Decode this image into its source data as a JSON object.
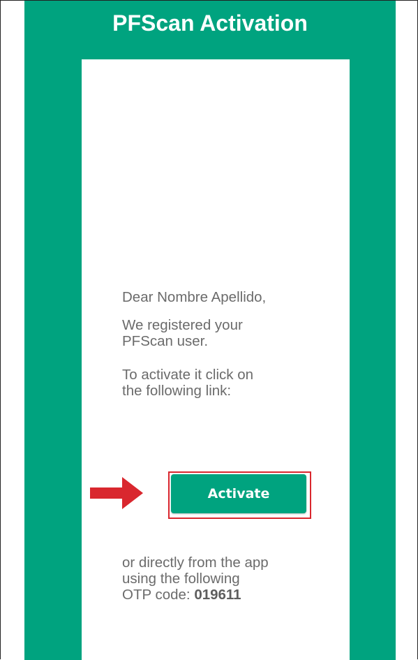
{
  "email": {
    "title": "PFScan Activation",
    "greeting": "Dear Nombre Apellido,",
    "registered_line1": "We registered your",
    "registered_line2": "PFScan user.",
    "activate_line1": "To activate it click on",
    "activate_line2": "the following link:",
    "activate_button": "Activate",
    "otp_line1": "or directly from the app",
    "otp_line2": "using the following",
    "otp_prefix": "OTP code: ",
    "otp_code": "019611"
  },
  "colors": {
    "accent": "#00a37f",
    "highlight": "#d9272e",
    "body_text": "#6b6b6b"
  },
  "icons": {
    "pointer_arrow": "red-right-arrow-icon"
  }
}
